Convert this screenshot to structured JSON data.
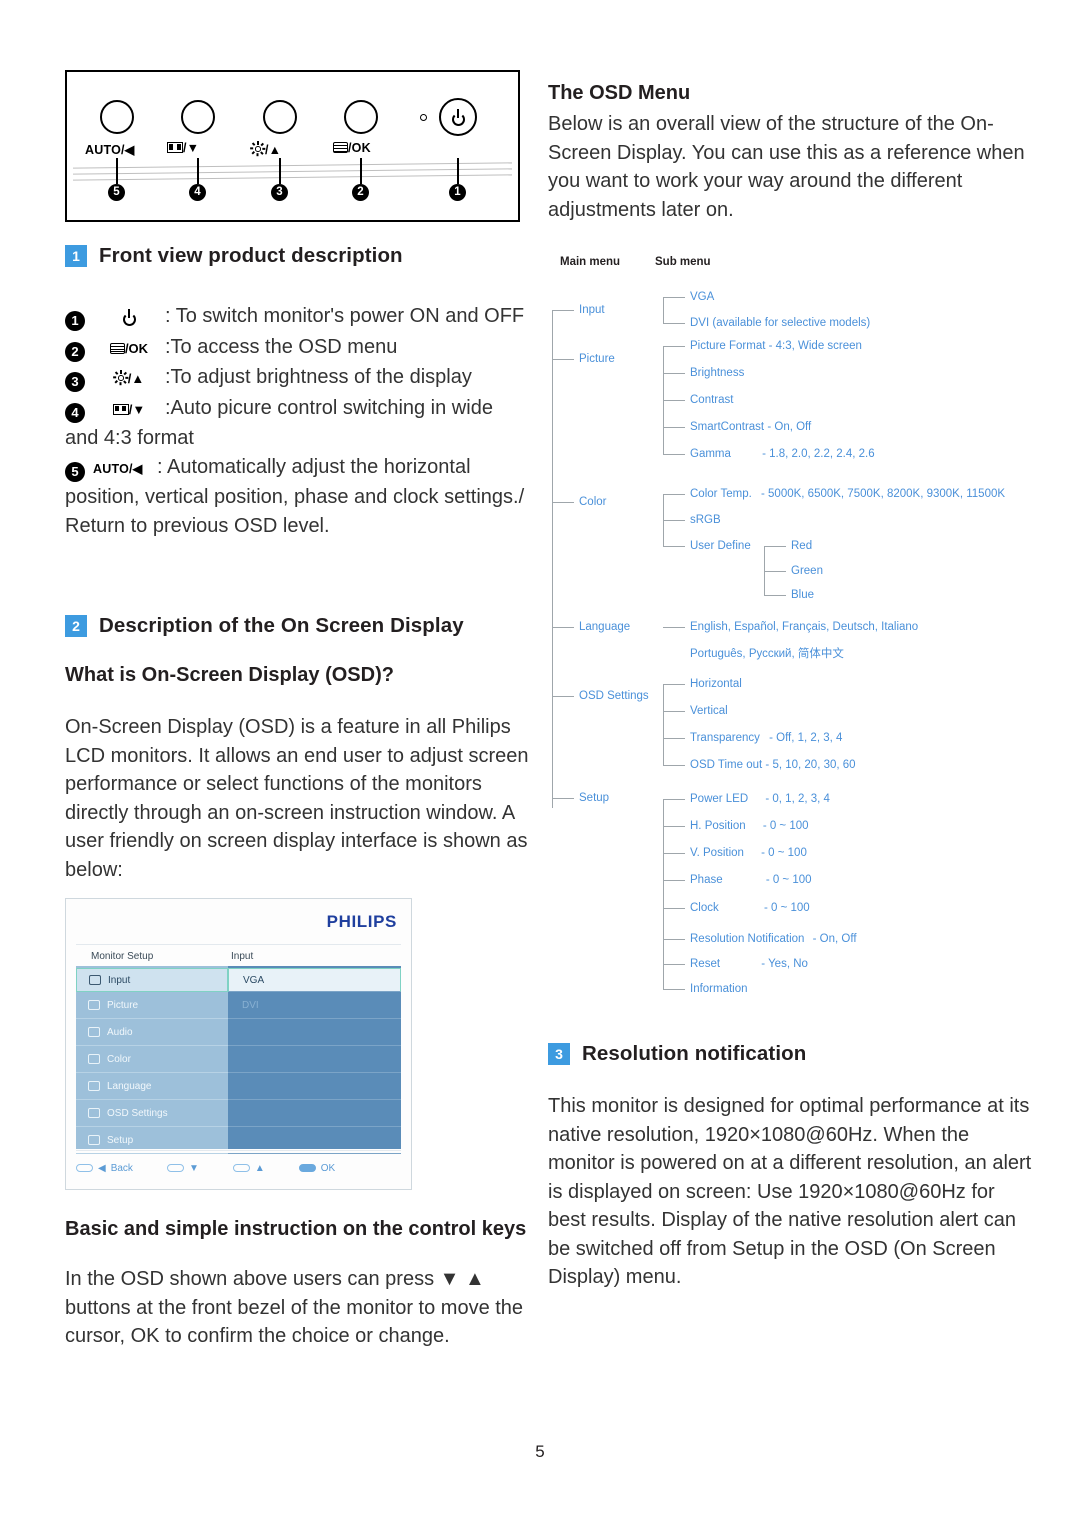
{
  "page_number": "5",
  "front_panel": {
    "buttons": [
      {
        "label": "AUTO/◀",
        "bullet": "5"
      },
      {
        "label": "/▼",
        "icon": "wide-picture-icon",
        "bullet": "4"
      },
      {
        "label": "/▲",
        "icon": "brightness-sun-icon",
        "bullet": "3"
      },
      {
        "label": "/OK",
        "icon": "menu-icon",
        "bullet": "2"
      },
      {
        "label": "",
        "icon": "power-icon",
        "bullet": "1"
      }
    ]
  },
  "section1": {
    "badge": "1",
    "title": "Front view product description",
    "keys": [
      {
        "num": "1",
        "icon": "power-icon",
        "icon_text": "",
        "text": ": To switch monitor's power ON and OFF"
      },
      {
        "num": "2",
        "icon": "menu-icon",
        "icon_text": "/OK",
        "text": ":To access the OSD menu"
      },
      {
        "num": "3",
        "icon": "brightness-sun-icon",
        "icon_text": "/▲",
        "text": ":To adjust brightness of the display"
      },
      {
        "num": "4",
        "icon": "wide-picture-icon",
        "icon_text": "/▼",
        "text": ":Auto picure control switching in wide"
      }
    ],
    "key4_continued": "and 4:3 format",
    "key5": {
      "num": "5",
      "icon_text": "AUTO/◀",
      "text": ": Automatically adjust the horizontal"
    },
    "key5_continued": "position, vertical position, phase and clock settings./ Return to previous OSD level."
  },
  "section2": {
    "badge": "2",
    "title": "Description of the On Screen Display",
    "subheading": "What is On-Screen Display (OSD)?",
    "paragraph": "On-Screen Display (OSD) is a feature in all Philips LCD monitors. It allows an end user to adjust screen performance or select functions of the monitors directly through an on-screen instruction window. A user friendly on screen display interface is shown as below:"
  },
  "osd_screenshot": {
    "brand": "PHILIPS",
    "header_left": "Monitor Setup",
    "header_right": "Input",
    "left_items": [
      {
        "label": "Input",
        "icon": "input-icon",
        "selected": true
      },
      {
        "label": "Picture",
        "icon": "picture-icon",
        "selected": false
      },
      {
        "label": "Audio",
        "icon": "audio-icon",
        "selected": false
      },
      {
        "label": "Color",
        "icon": "color-icon",
        "selected": false
      },
      {
        "label": "Language",
        "icon": "language-icon",
        "selected": false
      },
      {
        "label": "OSD Settings",
        "icon": "osd-settings-icon",
        "selected": false
      },
      {
        "label": "Setup",
        "icon": "setup-icon",
        "selected": false
      }
    ],
    "right_items": [
      {
        "label": "VGA",
        "selected": true
      },
      {
        "label": "DVI",
        "selected": false
      }
    ],
    "footer": [
      {
        "icon": "key-pill",
        "glyph": "◀",
        "label": "Back"
      },
      {
        "icon": "key-pill",
        "glyph": "▼",
        "label": ""
      },
      {
        "icon": "key-pill",
        "glyph": "▲",
        "label": ""
      },
      {
        "icon": "key-pill-filled",
        "glyph": "",
        "label": "OK"
      }
    ]
  },
  "control_keys": {
    "heading": "Basic and simple instruction on the control keys",
    "text_before": "In the OSD shown above users can press",
    "glyph_down": "▼",
    "glyph_up": "▲",
    "text_after": "buttons at the front bezel of the monitor to move the cursor,",
    "ok_label": "OK",
    "text_end": "to confirm the choice or change."
  },
  "osd_menu_intro": {
    "heading": "The OSD Menu",
    "paragraph": "Below is an overall view of the structure of the On-Screen Display. You can use this as a reference when you want to work your way around the different adjustments later on."
  },
  "tree": {
    "col_header_main": "Main menu",
    "col_header_sub": "Sub menu",
    "main": [
      {
        "label": "Input"
      },
      {
        "label": "Picture"
      },
      {
        "label": "Color"
      },
      {
        "label": "Language"
      },
      {
        "label": "OSD Settings"
      },
      {
        "label": "Setup"
      }
    ],
    "sub": {
      "input": [
        {
          "label": "VGA",
          "values": ""
        },
        {
          "label": "DVI (available for selective models)",
          "values": ""
        }
      ],
      "picture": [
        {
          "label": "Picture Format",
          "values": "- 4:3, Wide screen"
        },
        {
          "label": "Brightness",
          "values": ""
        },
        {
          "label": "Contrast",
          "values": ""
        },
        {
          "label": "SmartContrast",
          "values": "- On, Off"
        },
        {
          "label": "Gamma",
          "values": "- 1.8, 2.0, 2.2, 2.4, 2.6"
        }
      ],
      "color": [
        {
          "label": "Color Temp.",
          "values": "- 5000K, 6500K, 7500K, 8200K, 9300K, 11500K"
        },
        {
          "label": "sRGB",
          "values": ""
        },
        {
          "label": "User Define",
          "values": ""
        }
      ],
      "user_define": [
        {
          "label": "Red"
        },
        {
          "label": "Green"
        },
        {
          "label": "Blue"
        }
      ],
      "language": [
        {
          "label": "English, Español, Français, Deutsch, Italiano"
        },
        {
          "label": "Português, Русский, 简体中文"
        }
      ],
      "osd_settings": [
        {
          "label": "Horizontal",
          "values": ""
        },
        {
          "label": "Vertical",
          "values": ""
        },
        {
          "label": "Transparency",
          "values": "- Off, 1, 2, 3, 4"
        },
        {
          "label": "OSD Time out",
          "values": "- 5, 10, 20, 30, 60"
        }
      ],
      "setup": [
        {
          "label": "Power LED",
          "values": "- 0, 1, 2, 3, 4"
        },
        {
          "label": "H. Position",
          "values": "- 0 ~ 100"
        },
        {
          "label": "V. Position",
          "values": "- 0 ~ 100"
        },
        {
          "label": "Phase",
          "values": "- 0 ~ 100"
        },
        {
          "label": "Clock",
          "values": "- 0 ~ 100"
        },
        {
          "label": "Resolution Notification",
          "values": "- On, Off"
        },
        {
          "label": "Reset",
          "values": "- Yes, No"
        },
        {
          "label": "Information",
          "values": ""
        }
      ]
    }
  },
  "section3": {
    "badge": "3",
    "title": "Resolution notification",
    "paragraph": "This monitor is designed for optimal performance at its native resolution, 1920×1080@60Hz. When the monitor is powered on at a different resolution, an alert is displayed on screen: Use 1920×1080@60Hz for best results. Display of the native resolution alert can be switched off from Setup in the OSD (On Screen Display) menu."
  }
}
